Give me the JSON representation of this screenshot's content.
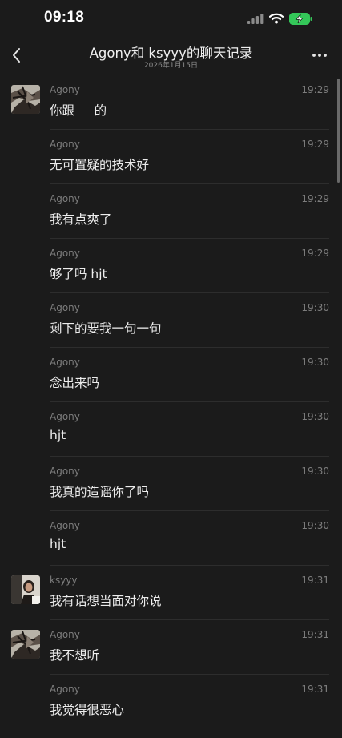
{
  "status_bar": {
    "time": "09:18",
    "icons": [
      "signal-icon",
      "wifi-icon",
      "battery-charging-icon"
    ],
    "battery_color": "#34c759"
  },
  "nav": {
    "back_icon": "chevron-left-icon",
    "title": "Agony和 ksyyy的聊天记录",
    "subtitle": "2026年1月15日",
    "more_icon": "more-dots-icon"
  },
  "messages": [
    {
      "sender": "Agony",
      "time": "19:29",
      "text": "你跟     的",
      "avatar": "agony"
    },
    {
      "sender": "Agony",
      "time": "19:29",
      "text": "无可置疑的技术好",
      "avatar": ""
    },
    {
      "sender": "Agony",
      "time": "19:29",
      "text": "我有点爽了",
      "avatar": ""
    },
    {
      "sender": "Agony",
      "time": "19:29",
      "text": "够了吗 hjt",
      "avatar": ""
    },
    {
      "sender": "Agony",
      "time": "19:30",
      "text": "剩下的要我一句一句",
      "avatar": ""
    },
    {
      "sender": "Agony",
      "time": "19:30",
      "text": "念出来吗",
      "avatar": ""
    },
    {
      "sender": "Agony",
      "time": "19:30",
      "text": "hjt",
      "avatar": ""
    },
    {
      "sender": "Agony",
      "time": "19:30",
      "text": "我真的造谣你了吗",
      "avatar": ""
    },
    {
      "sender": "Agony",
      "time": "19:30",
      "text": "hjt",
      "avatar": ""
    },
    {
      "sender": "ksyyy",
      "time": "19:31",
      "text": "我有话想当面对你说",
      "avatar": "ksyyy"
    },
    {
      "sender": "Agony",
      "time": "19:31",
      "text": "我不想听",
      "avatar": "agony"
    },
    {
      "sender": "Agony",
      "time": "19:31",
      "text": "我觉得很恶心",
      "avatar": ""
    }
  ]
}
